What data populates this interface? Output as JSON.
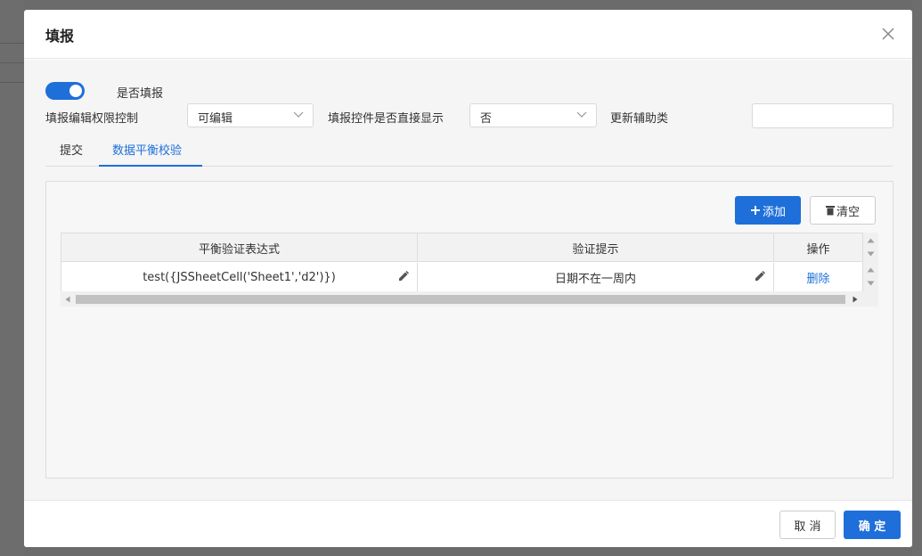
{
  "dialog": {
    "title": "填报",
    "fill_toggle": {
      "label": "是否填报",
      "on": true
    },
    "permission": {
      "label": "填报编辑权限控制",
      "value": "可编辑"
    },
    "direct_display": {
      "label": "填报控件是否直接显示",
      "value": "否"
    },
    "helper_class": {
      "label": "更新辅助类",
      "value": ""
    },
    "tabs": [
      {
        "label": "提交",
        "active": false
      },
      {
        "label": "数据平衡校验",
        "active": true
      }
    ],
    "panel": {
      "add_label": "添加",
      "clear_label": "清空",
      "columns": [
        "平衡验证表达式",
        "验证提示",
        "操作"
      ],
      "rows": [
        {
          "expression": "test({JSSheetCell('Sheet1','d2')})",
          "hint": "日期不在一周内",
          "action": "删除"
        }
      ]
    },
    "footer": {
      "cancel_label": "取 消",
      "ok_label": "确 定"
    }
  },
  "colors": {
    "primary": "#1e6fd9",
    "overlay": "#6b6b6b",
    "body_bg": "#f5f5f5"
  },
  "icons": [
    "close-icon",
    "chevron-down-icon",
    "plus-icon",
    "trash-icon",
    "pencil-icon",
    "scroll-arrow-icon"
  ]
}
